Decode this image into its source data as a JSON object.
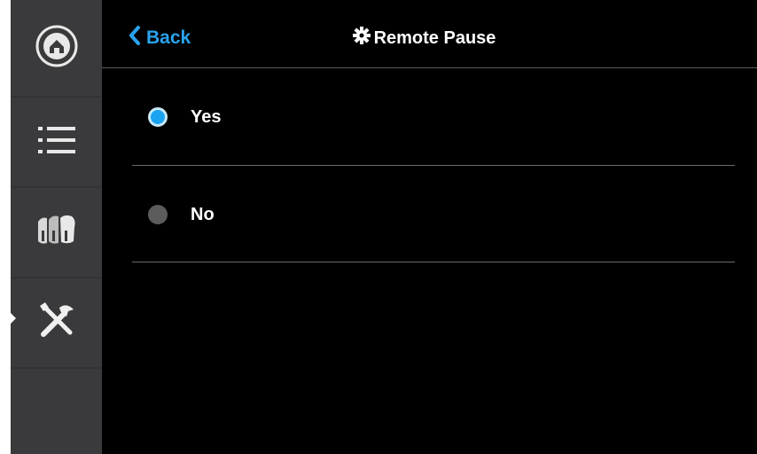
{
  "header": {
    "back_label": "Back",
    "title": "Remote Pause",
    "title_icon": "gear-icon",
    "back_icon": "chevron-left-icon"
  },
  "sidebar": {
    "items": [
      {
        "name": "home",
        "icon": "home-icon"
      },
      {
        "name": "list",
        "icon": "list-icon"
      },
      {
        "name": "materials",
        "icon": "filament-spools-icon"
      },
      {
        "name": "settings",
        "icon": "tools-icon",
        "active": true
      },
      {
        "name": "empty",
        "icon": ""
      }
    ]
  },
  "options": [
    {
      "label": "Yes",
      "selected": true
    },
    {
      "label": "No",
      "selected": false
    }
  ],
  "colors": {
    "accent": "#1aa3f0",
    "background": "#000000",
    "sidebar": "#3a3a3c"
  }
}
